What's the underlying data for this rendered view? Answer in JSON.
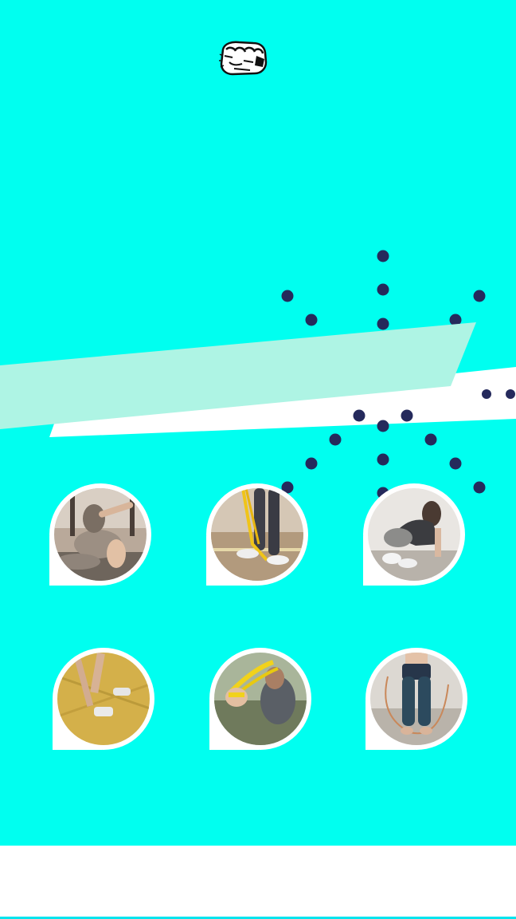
{
  "brand": {
    "logo_icon": "fist-punch-icon"
  },
  "colors": {
    "background": "#00fff0",
    "ribbon": "#aef4e4",
    "ribbon_shadow": "#ffffff",
    "dots": "#252a5c",
    "footer": "#ffffff"
  },
  "workouts": [
    {
      "id": "seated-stretch",
      "icon": "seated-stretch-photo"
    },
    {
      "id": "resistance-band-legs",
      "icon": "resistance-band-legs-photo"
    },
    {
      "id": "mountain-climber",
      "icon": "mountain-climber-photo"
    },
    {
      "id": "pushup-handles",
      "icon": "pushup-handles-photo"
    },
    {
      "id": "resistance-band-arms",
      "icon": "resistance-band-arms-photo"
    },
    {
      "id": "jump-rope",
      "icon": "jump-rope-photo"
    }
  ]
}
